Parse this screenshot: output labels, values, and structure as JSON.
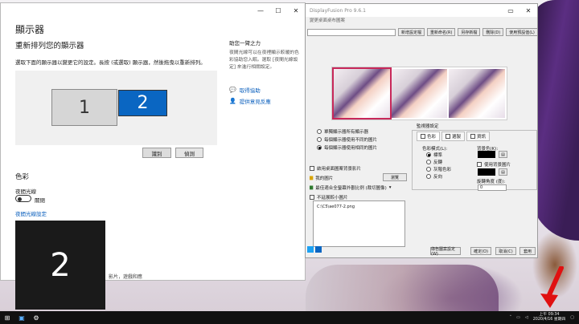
{
  "settings": {
    "window_controls": [
      "—",
      "☐",
      "✕"
    ],
    "title": "顯示器",
    "rearrange_heading": "重新排列您的顯示器",
    "description": "選取下面的顯示器以變更它的設定。長按 (或選取) 顯示器，然後拖曳以重新排列。",
    "monitor1": "1",
    "monitor2": "2",
    "identify_button": "識別",
    "detect_button": "偵測",
    "side_heading": "助您一臂之力",
    "side_text": "夜間光線可以在夜裡顯示較暖的色彩協助您入眠。選取 [夜間光線設定] 來進行相關設定。",
    "help_links": [
      "取得協助",
      "提供意見反應"
    ],
    "color_heading": "色彩",
    "night_light_label": "夜間光線",
    "night_light_state": "關閉",
    "night_light_link": "夜間光線設定",
    "footnote": "影片，遊戲和應"
  },
  "identify_overlay": "2",
  "displayfusion": {
    "title": "DisplayFusion Pro 9.6.1",
    "subtitle": "變更桌面桌布圖案",
    "top_buttons": [
      "新增設定檔",
      "重新命名(R)",
      "另存新檔",
      "刪除(D)",
      "使用預設值(L)"
    ],
    "wallpaper_radios": [
      "單獨顯示器所有顯示器",
      "每個顯示器使用不同的圖片",
      "每個顯示器使用相同的圖片"
    ],
    "wallpaper_selected": 2,
    "enable_checkbox": "啟用桌面圖案背景影片",
    "my_images": "我的圖片",
    "browse_button": "瀏覽",
    "fit_mode": "最佳適合全螢幕外觀比例 (裁切圖像)",
    "no_scale_checkbox": "不延展較小圖片",
    "file_path": "C:\\C5\\ae077-2.png",
    "monitor_settings_heading": "監視器設定",
    "tabs": [
      "色彩",
      "選製",
      "資訊"
    ],
    "color_mode_label": "色彩模式(L):",
    "color_modes": [
      "標準",
      "反轉",
      "灰階色彩",
      "反向"
    ],
    "color_mode_selected": 0,
    "bg_color_label": "背景色(K):",
    "use_bg_image": "使用背景圖片",
    "rotate_label": "旋轉角度 (度):",
    "rotate_value": "0",
    "bottom_buttons": [
      "綠色圖案設定(W)",
      "確定(O)",
      "取消(C)",
      "套用"
    ]
  },
  "taskbar": {
    "time": "上午 09:34",
    "date": "2020/4/16 星期四"
  }
}
